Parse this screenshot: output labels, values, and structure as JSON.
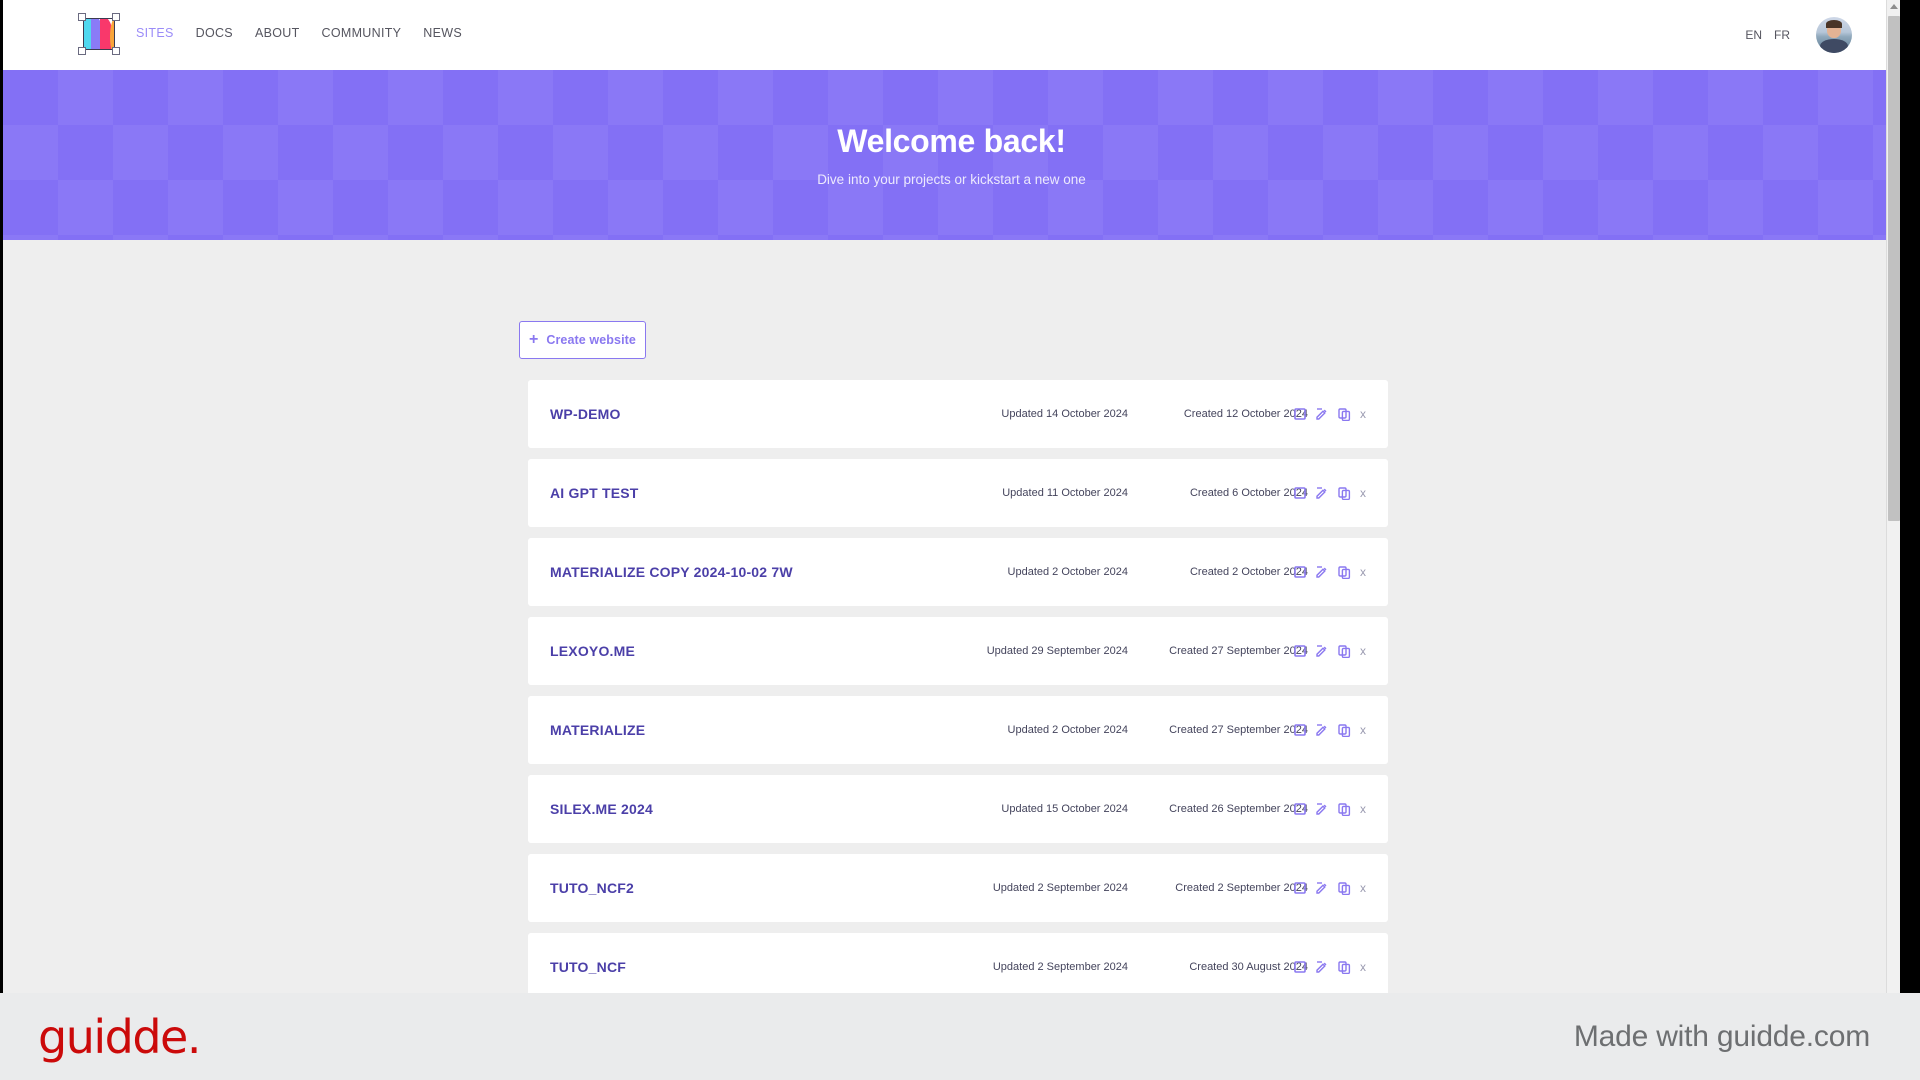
{
  "header": {
    "logo_name": "silex-logo",
    "nav": [
      {
        "label": "SITES",
        "active": true
      },
      {
        "label": "DOCS",
        "active": false
      },
      {
        "label": "ABOUT",
        "active": false
      },
      {
        "label": "COMMUNITY",
        "active": false
      },
      {
        "label": "NEWS",
        "active": false
      }
    ],
    "languages": [
      {
        "label": "EN"
      },
      {
        "label": "FR"
      }
    ],
    "avatar_label": "User profile"
  },
  "hero": {
    "title": "Welcome back!",
    "subtitle": "Dive into your projects or kickstart a new one",
    "background_color": "#8370f5"
  },
  "toolbar": {
    "create_website_plus": "+",
    "create_website_label": "Create website"
  },
  "sites": [
    {
      "name": "WP-DEMO",
      "updated": "Updated 14 October 2024",
      "created": "Created 12 October 2024"
    },
    {
      "name": "AI GPT TEST",
      "updated": "Updated 11 October 2024",
      "created": "Created 6 October 2024"
    },
    {
      "name": "MATERIALIZE COPY 2024-10-02 7W",
      "updated": "Updated 2 October 2024",
      "created": "Created 2 October 2024"
    },
    {
      "name": "LEXOYO.ME",
      "updated": "Updated 29 September 2024",
      "created": "Created 27 September 2024"
    },
    {
      "name": "MATERIALIZE",
      "updated": "Updated 2 October 2024",
      "created": "Created 27 September 2024"
    },
    {
      "name": "SILEX.ME 2024",
      "updated": "Updated 15 October 2024",
      "created": "Created 26 September 2024"
    },
    {
      "name": "TUTO_NCF2",
      "updated": "Updated 2 September 2024",
      "created": "Created 2 September 2024"
    },
    {
      "name": "TUTO_NCF",
      "updated": "Updated 2 September 2024",
      "created": "Created 30 August 2024"
    }
  ],
  "row_actions": {
    "preview_label": "Preview",
    "edit_label": "Edit",
    "duplicate_label": "Duplicate",
    "delete_label": "x"
  },
  "footer": {
    "logo_text": "guidde.",
    "made_with": "Made with guidde.com",
    "logo_color": "#cb0a0a"
  },
  "accent_color": "#8a78f0"
}
